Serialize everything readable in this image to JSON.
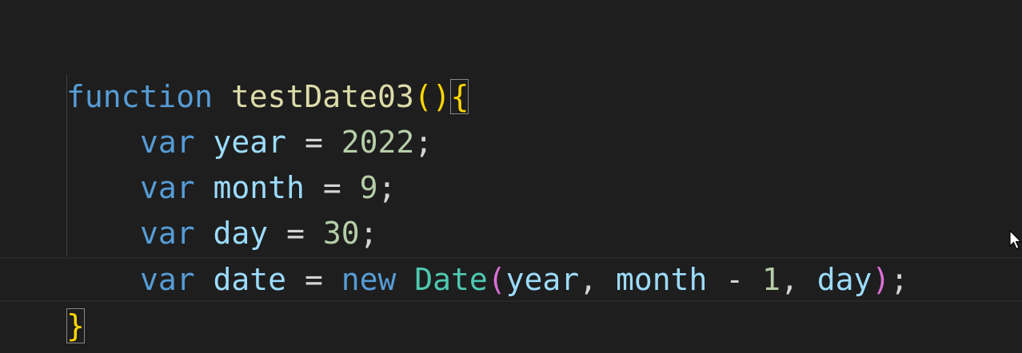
{
  "code": {
    "line1": {
      "keyword": "function",
      "name": "testDate03",
      "parens": "()",
      "open_brace": "{"
    },
    "line2": {
      "keyword": "var",
      "name": "year",
      "eq": "=",
      "value": "2022",
      "semi": ";"
    },
    "line3": {
      "keyword": "var",
      "name": "month",
      "eq": "=",
      "value": "9",
      "semi": ";"
    },
    "line4": {
      "keyword": "var",
      "name": "day",
      "eq": "=",
      "value": "30",
      "semi": ";"
    },
    "line5": {
      "keyword": "var",
      "name": "date",
      "eq": "=",
      "new_kw": "new",
      "class_name": "Date",
      "open_paren": "(",
      "arg1": "year",
      "comma1": ",",
      "arg2": "month",
      "minus": "-",
      "arg2_num": "1",
      "comma2": ",",
      "arg3": "day",
      "close_paren": ")",
      "semi": ";"
    },
    "line6": {
      "close_brace": "}"
    }
  },
  "colors": {
    "background": "#1e1e1e",
    "keyword": "#569cd6",
    "function": "#dcdcaa",
    "variable": "#9cdcfe",
    "number": "#b5cea8",
    "class": "#4ec9b0",
    "brace_level1": "#ffd700",
    "paren_level2": "#da70d6"
  },
  "icons": {
    "mouse_cursor": "mouse-pointer-icon"
  }
}
